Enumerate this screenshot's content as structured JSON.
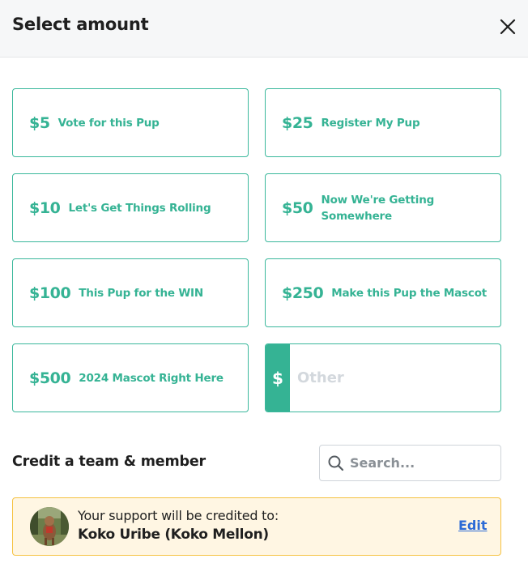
{
  "header": {
    "title": "Select amount",
    "close_icon": "close-icon"
  },
  "amounts": [
    {
      "value": "$5",
      "label": "Vote for this Pup"
    },
    {
      "value": "$25",
      "label": "Register My Pup"
    },
    {
      "value": "$10",
      "label": "Let's Get Things Rolling"
    },
    {
      "value": "$50",
      "label": "Now We're Getting Somewhere"
    },
    {
      "value": "$100",
      "label": "This Pup for the WIN"
    },
    {
      "value": "$250",
      "label": "Make this Pup the Mascot"
    },
    {
      "value": "$500",
      "label": "2024 Mascot Right Here"
    }
  ],
  "other": {
    "prefix": "$",
    "placeholder": "Other",
    "value": ""
  },
  "credit": {
    "label": "Credit a team & member",
    "search_placeholder": "Search...",
    "search_icon": "search-icon",
    "notice": "Your support will be credited to:",
    "member_name": "Koko Uribe (Koko Mellon)",
    "edit_label": "Edit"
  },
  "colors": {
    "accent": "#35b394",
    "notice_bg": "#fff6e3",
    "notice_border": "#f5c242",
    "link": "#2c6bd6"
  }
}
